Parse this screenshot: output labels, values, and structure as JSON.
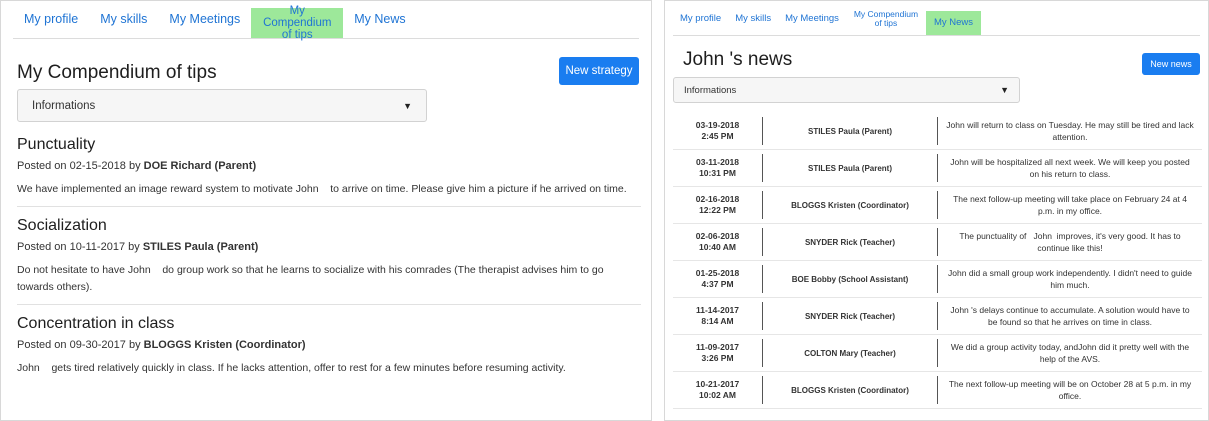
{
  "left": {
    "tabs": [
      {
        "label": "My profile",
        "active": false
      },
      {
        "label": "My skills",
        "active": false
      },
      {
        "label": "My Meetings",
        "active": false
      },
      {
        "label": "My Compendium of tips",
        "active": true
      },
      {
        "label": "My News",
        "active": false
      }
    ],
    "page_title": "My Compendium of tips",
    "new_button_label": "New strategy",
    "dropdown_label": "Informations",
    "posted_prefix": "Posted on",
    "by_word": "by",
    "tips": [
      {
        "title": "Punctuality",
        "date": "02-15-2018",
        "author": "DOE Richard (Parent)",
        "body": "We have implemented an image reward system to motivate John    to arrive on time. Please give him a picture if he arrived on time."
      },
      {
        "title": "Socialization",
        "date": "10-11-2017",
        "author": "STILES Paula (Parent)",
        "body": "Do not hesitate to have John    do group work so that he learns to socialize with his comrades (The therapist advises him to go towards others)."
      },
      {
        "title": "Concentration in class",
        "date": "09-30-2017",
        "author": "BLOGGS Kristen (Coordinator)",
        "body": "John    gets tired relatively quickly in class. If he lacks attention, offer to rest for a few minutes before resuming activity."
      }
    ]
  },
  "right": {
    "tabs": [
      {
        "label": "My profile",
        "active": false
      },
      {
        "label": "My skills",
        "active": false
      },
      {
        "label": "My Meetings",
        "active": false
      },
      {
        "label": "My Compendium of tips",
        "active": false
      },
      {
        "label": "My News",
        "active": true
      }
    ],
    "page_title": "John 's news",
    "new_button_label": "New news",
    "dropdown_label": "Informations",
    "news": [
      {
        "date": "03-19-2018",
        "time": "2:45 PM",
        "author": "STILES Paula (Parent)",
        "text": "John will return to class on Tuesday. He may still be tired and lack attention."
      },
      {
        "date": "03-11-2018",
        "time": "10:31 PM",
        "author": "STILES Paula (Parent)",
        "text": "John will be hospitalized all next week. We will keep you posted on his return to class."
      },
      {
        "date": "02-16-2018",
        "time": "12:22 PM",
        "author": "BLOGGS Kristen (Coordinator)",
        "text": "The next follow-up meeting will take place on February 24 at 4 p.m. in my office."
      },
      {
        "date": "02-06-2018",
        "time": "10:40 AM",
        "author": "SNYDER Rick (Teacher)",
        "text": "The punctuality of   John  improves, it's very good. It has to continue like this!"
      },
      {
        "date": "01-25-2018",
        "time": "4:37 PM",
        "author": "BOE Bobby (School Assistant)",
        "text": "John did a small group work independently. I didn't need to guide him much."
      },
      {
        "date": "11-14-2017",
        "time": "8:14 AM",
        "author": "SNYDER Rick (Teacher)",
        "text": "John 's delays continue to accumulate. A solution would have to be found so that he arrives on time in class."
      },
      {
        "date": "11-09-2017",
        "time": "3:26 PM",
        "author": "COLTON Mary (Teacher)",
        "text": "We did a group activity today, andJohn did it pretty well with the help of the AVS."
      },
      {
        "date": "10-21-2017",
        "time": "10:02 AM",
        "author": "BLOGGS Kristen (Coordinator)",
        "text": "The next follow-up meeting will be on October 28 at 5 p.m. in my office."
      }
    ]
  },
  "colors": {
    "accent": "#1a7df0",
    "active_tab": "#9de89a",
    "link": "#1f74d4"
  },
  "icons": {
    "dropdown": "caret-down-icon"
  }
}
